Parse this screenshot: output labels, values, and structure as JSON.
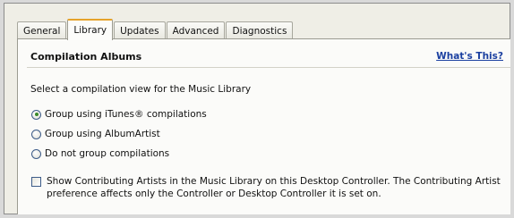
{
  "tabs": [
    {
      "label": "General",
      "active": false
    },
    {
      "label": "Library",
      "active": true
    },
    {
      "label": "Updates",
      "active": false
    },
    {
      "label": "Advanced",
      "active": false
    },
    {
      "label": "Diagnostics",
      "active": false
    }
  ],
  "section": {
    "title": "Compilation Albums",
    "help_link": "What's This?",
    "prompt": "Select a compilation view for the Music Library"
  },
  "options": [
    {
      "label": "Group using iTunes® compilations",
      "selected": true
    },
    {
      "label": "Group using AlbumArtist",
      "selected": false
    },
    {
      "label": "Do not group compilations",
      "selected": false
    }
  ],
  "contributing_artists": {
    "label": "Show Contributing Artists in the Music Library on this Desktop Controller.  The Contributing Artist preference affects only the Controller or Desktop Controller it is set on.",
    "checked": false
  },
  "colors": {
    "active_tab_accent": "#e6a32b",
    "link": "#1a3fa0",
    "radio_dot": "#3a8a2a"
  }
}
